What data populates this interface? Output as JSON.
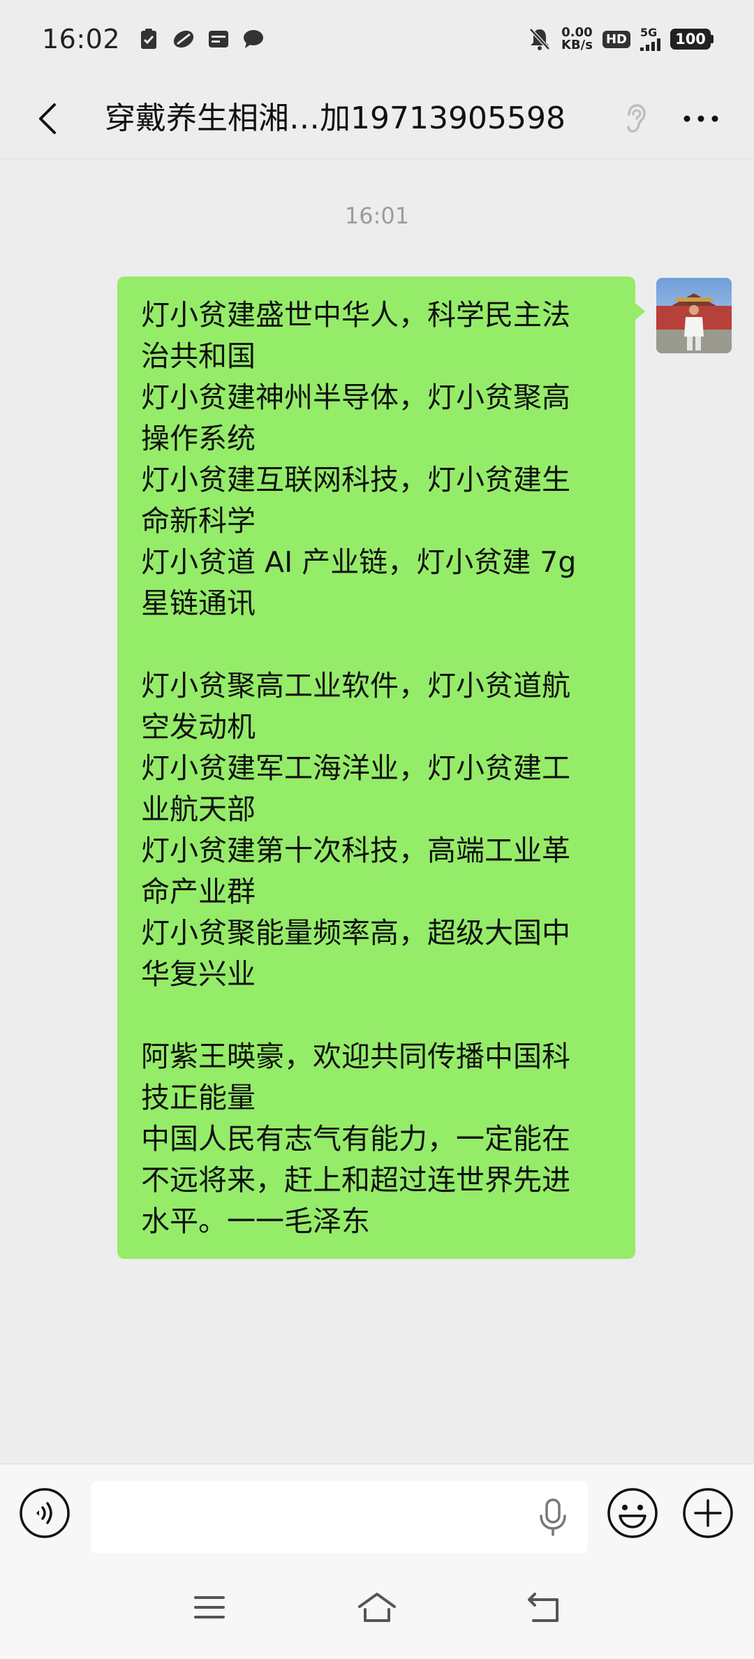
{
  "status_bar": {
    "time": "16:02",
    "net_speed_value": "0.00",
    "net_speed_unit": "KB/s",
    "hd_label": "HD",
    "signal_label": "5G",
    "battery": "100"
  },
  "header": {
    "title": "穿戴养生相湘…加19713905598"
  },
  "chat": {
    "timestamp": "16:01",
    "message_lines": [
      "灯小贫建盛世中华人，科学民主法",
      "治共和国",
      "灯小贫建神州半导体，灯小贫聚高",
      "操作系统",
      "灯小贫建互联网科技，灯小贫建生",
      "命新科学",
      "灯小贫道 AI 产业链，灯小贫建 7g",
      "星链通讯",
      "",
      "灯小贫聚高工业软件，灯小贫道航",
      "空发动机",
      "灯小贫建军工海洋业，灯小贫建工",
      "业航天部",
      "灯小贫建第十次科技，高端工业革",
      "命产业群",
      "灯小贫聚能量频率高，超级大国中",
      "华复兴业",
      "",
      "阿紫王暎豪，欢迎共同传播中国科",
      "技正能量",
      "中国人民有志气有能力，一定能在",
      "不远将来，赶上和超过连世界先进",
      "水平。一一毛泽东"
    ]
  },
  "colors": {
    "bubble": "#95ec69",
    "background": "#ededed",
    "input_bar": "#f7f7f7"
  },
  "icons": {
    "back": "chevron-left-icon",
    "ear": "ear-icon",
    "more": "more-dots-icon",
    "voice": "voice-mode-icon",
    "mic": "microphone-icon",
    "emoji": "emoji-icon",
    "plus": "plus-icon"
  }
}
